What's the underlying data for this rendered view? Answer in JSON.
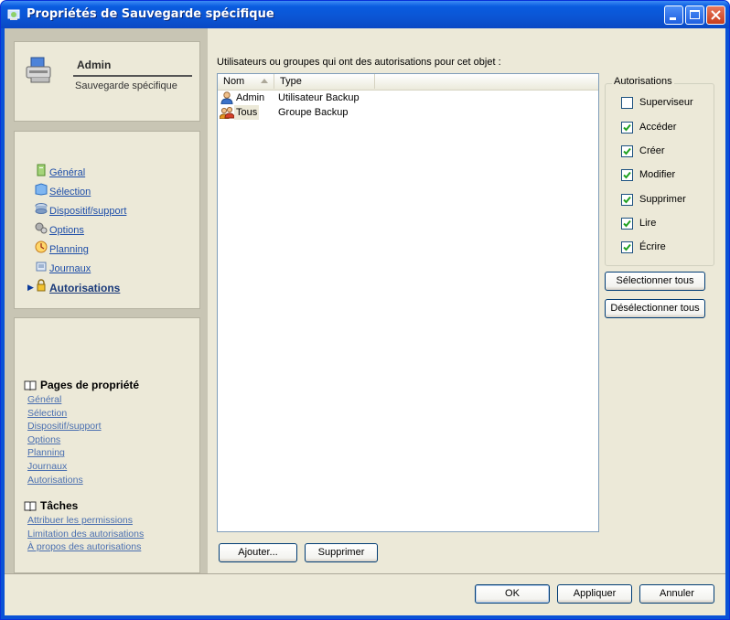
{
  "window": {
    "title": "Propriétés de Sauvegarde spécifique",
    "controls": [
      "minimize-icon",
      "maximize-icon",
      "close-icon"
    ]
  },
  "header_panel": {
    "name": "Admin",
    "subtitle": "Sauvegarde spécifique"
  },
  "nav": {
    "items": [
      {
        "label": "Général",
        "icon": "general-icon"
      },
      {
        "label": "Sélection",
        "icon": "selection-icon"
      },
      {
        "label": "Dispositif/support",
        "icon": "device-icon"
      },
      {
        "label": "Options",
        "icon": "options-icon"
      },
      {
        "label": "Planning",
        "icon": "schedule-icon"
      },
      {
        "label": "Journaux",
        "icon": "logs-icon"
      },
      {
        "label": "Autorisations",
        "icon": "lock-icon",
        "active": true
      }
    ]
  },
  "property_pages": {
    "title": "Pages de propriété",
    "links": [
      "Général",
      "Sélection",
      "Dispositif/support",
      "Options",
      "Planning",
      "Journaux",
      "Autorisations"
    ]
  },
  "tasks": {
    "title": "Tâches",
    "links": [
      "Attribuer les permissions",
      "Limitation des autorisations",
      "À propos des autorisations"
    ]
  },
  "main": {
    "description": "Utilisateurs ou groupes qui ont des autorisations pour cet objet :",
    "columns": [
      "Nom",
      "Type"
    ],
    "rows": [
      {
        "name": "Admin",
        "type": "Utilisateur Backup",
        "icon": "user-icon"
      },
      {
        "name": "Tous",
        "type": "Groupe Backup",
        "icon": "group-icon"
      }
    ],
    "add_label": "Ajouter...",
    "remove_label": "Supprimer"
  },
  "permissions": {
    "title": "Autorisations",
    "items": [
      {
        "label": "Superviseur",
        "checked": false
      },
      {
        "label": "Accéder",
        "checked": true
      },
      {
        "label": "Créer",
        "checked": true
      },
      {
        "label": "Modifier",
        "checked": true
      },
      {
        "label": "Supprimer",
        "checked": true
      },
      {
        "label": "Lire",
        "checked": true
      },
      {
        "label": "Écrire",
        "checked": true
      }
    ],
    "select_all_label": "Sélectionner tous",
    "deselect_all_label": "Désélectionner tous"
  },
  "footer": {
    "ok_label": "OK",
    "apply_label": "Appliquer",
    "cancel_label": "Annuler"
  },
  "colors": {
    "titlebar": "#0a5ce0",
    "link": "#1d4da8",
    "check": "#21a121"
  }
}
